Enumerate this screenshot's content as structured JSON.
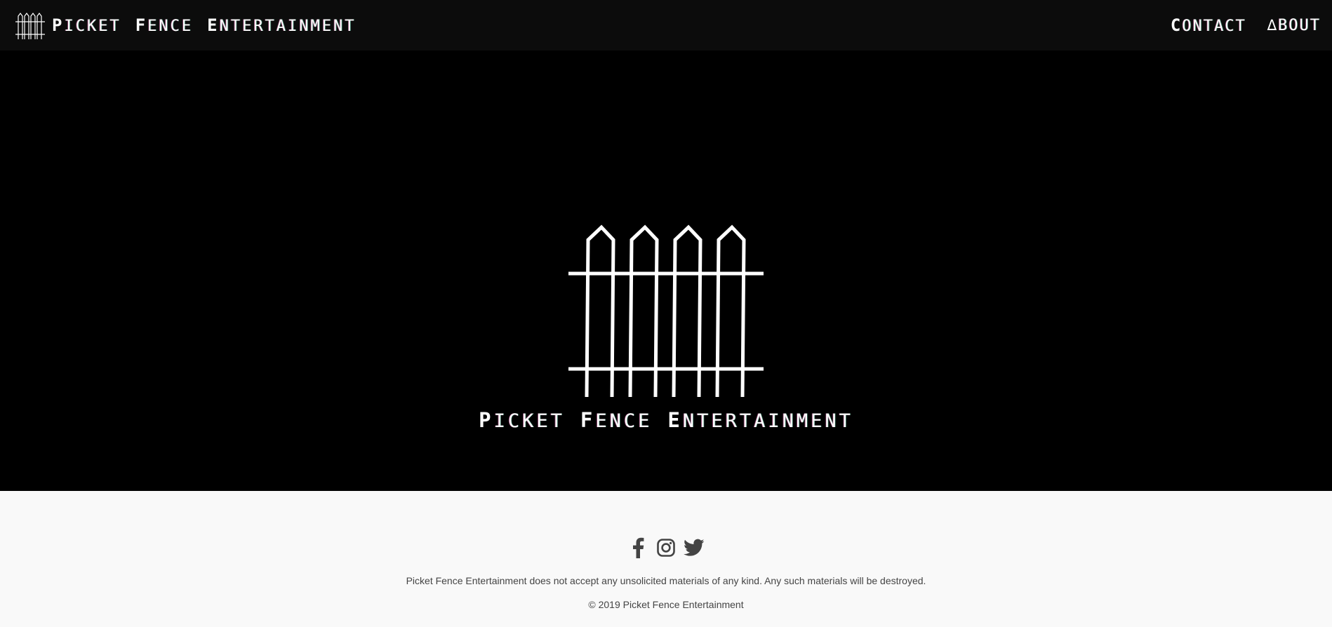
{
  "brand": {
    "words": [
      {
        "cap": "P",
        "rest": "ICKET"
      },
      {
        "cap": "F",
        "rest": "ENCE"
      },
      {
        "cap": "E",
        "rest": "NTERTAINMENT"
      }
    ]
  },
  "nav": {
    "contact": {
      "cap": "C",
      "rest": "ONTACT"
    },
    "about": {
      "cap": "∆",
      "rest": "BOUT"
    }
  },
  "hero": {
    "words": [
      {
        "cap": "P",
        "rest": "ICKET"
      },
      {
        "cap": "F",
        "rest": "ENCE"
      },
      {
        "cap": "E",
        "rest": "NTERTAINMENT"
      }
    ]
  },
  "footer": {
    "social_icons": [
      "facebook-icon",
      "instagram-icon",
      "twitter-icon"
    ],
    "disclaimer": "Picket Fence Entertainment does not accept any unsolicited materials of any kind. Any such materials will be destroyed.",
    "copyright": "© 2019 Picket Fence Entertainment"
  },
  "colors": {
    "navbar_bg": "#0c0c0c",
    "hero_bg": "#000000",
    "footer_bg": "#f9f9f9",
    "footer_text": "#444444",
    "logo": "#ffffff"
  }
}
